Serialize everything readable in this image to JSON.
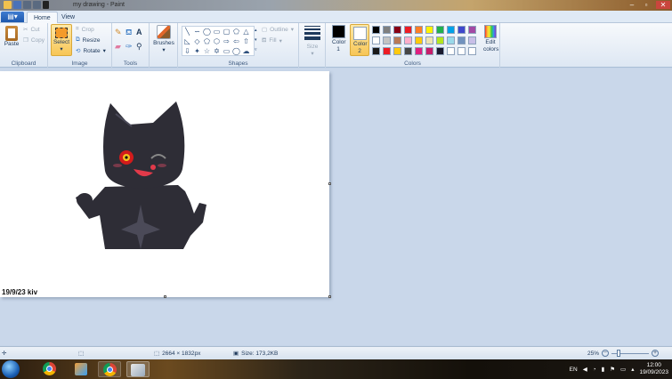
{
  "window": {
    "title": "my drawing - Paint"
  },
  "tabs": [
    {
      "label": "Home",
      "active": true
    },
    {
      "label": "View",
      "active": false
    }
  ],
  "ribbon": {
    "clipboard": {
      "label": "Clipboard",
      "paste": "Paste",
      "cut": "Cut",
      "copy": "Copy"
    },
    "image": {
      "label": "Image",
      "select": "Select",
      "crop": "Crop",
      "resize": "Resize",
      "rotate": "Rotate"
    },
    "tools": {
      "label": "Tools"
    },
    "brushes": {
      "label": "Brushes"
    },
    "shapes": {
      "label": "Shapes",
      "outline": "Outline",
      "fill": "Fill"
    },
    "size": {
      "label": "Size"
    },
    "colors": {
      "label": "Colors",
      "color1": "Color 1",
      "color2": "Color 2",
      "edit": "Edit colors",
      "color1_value": "#000000",
      "color2_value": "#ffffff",
      "palette_row1": [
        "#000000",
        "#7f7f7f",
        "#880015",
        "#ed1c24",
        "#ff7f27",
        "#fff200",
        "#22b14c",
        "#00a2e8",
        "#3f48cc",
        "#a349a4"
      ],
      "palette_row2": [
        "#ffffff",
        "#c3c3c3",
        "#b97a57",
        "#ffaec9",
        "#ffc90e",
        "#efe4b0",
        "#b5e61d",
        "#99d9ea",
        "#7092be",
        "#c8bfe7"
      ],
      "palette_row3": [
        "#1a1a1a",
        "#ed1c24",
        "#ffc90e",
        "#464646",
        "#e02080",
        "#c81e6a",
        "#1a1a2e",
        "#ffffff",
        "#ffffff",
        "#ffffff"
      ]
    }
  },
  "canvas": {
    "signature": "19/9/23 kiv"
  },
  "status": {
    "dimensions": "2664 × 1832px",
    "size": "Size: 173,2KB",
    "zoom": "25%"
  },
  "taskbar": {
    "lang": "EN",
    "time": "12:00",
    "date": "19/09/2023"
  }
}
